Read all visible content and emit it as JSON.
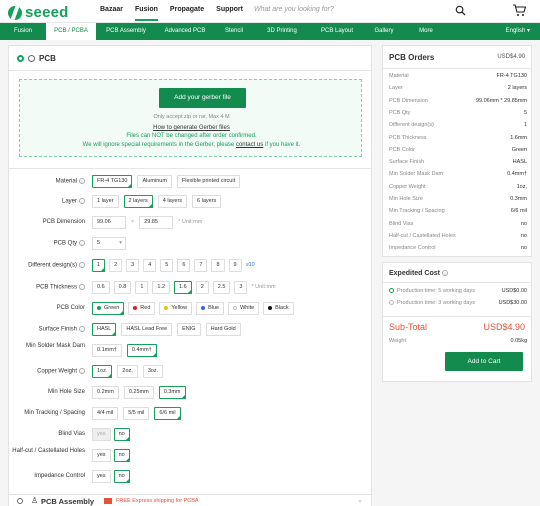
{
  "header": {
    "logo_text": "seeed",
    "nav": [
      "Bazaar",
      "Fusion",
      "Propagate",
      "Support"
    ],
    "search_placeholder": "What are you looking for?"
  },
  "subnav": {
    "items": [
      "Fusion",
      "PCB / PCBA",
      "PCB Assembly",
      "Advanced PCB",
      "Stencil",
      "3D Printing",
      "PCB Layout",
      "Gallery",
      "More"
    ],
    "active": "PCB / PCBA",
    "language": "English"
  },
  "pcb": {
    "title": "PCB",
    "upload": {
      "button": "Add your gerber file",
      "hint": "Only accept zip or rar, Max 4 M",
      "link": "How to generate Gerber files",
      "warn1": "Files can NOT be changed after order confirmed.",
      "warn2_pre": "We will ignore special requirements in the Gerber, please ",
      "warn2_link": "contact us",
      "warn2_post": " if you have it."
    },
    "fields": {
      "material": {
        "label": "Material",
        "options": [
          "FR-4 TG130",
          "Aluminum",
          "Flexible printed circuit"
        ],
        "selected": 0
      },
      "layer": {
        "label": "Layer",
        "options": [
          "1 layer",
          "2 layers",
          "4 layers",
          "6 layers"
        ],
        "selected": 1
      },
      "dimension": {
        "label": "PCB Dimension",
        "w": "99.06",
        "h": "29.85",
        "unit": "* Unit:mm"
      },
      "qty": {
        "label": "PCB Qty",
        "value": "5"
      },
      "designs": {
        "label": "Different design(s)",
        "options": [
          "1",
          "2",
          "3",
          "4",
          "5",
          "6",
          "7",
          "8",
          "9"
        ],
        "selected": 0,
        "extra": "≥10"
      },
      "thickness": {
        "label": "PCB Thickness",
        "options": [
          "0.6",
          "0.8",
          "1",
          "1.2",
          "1.6",
          "2",
          "2.5",
          "3"
        ],
        "selected": 4,
        "unit": "* Unit:mm"
      },
      "color": {
        "label": "PCB Color",
        "options": [
          {
            "name": "Green",
            "color": "#16a05a"
          },
          {
            "name": "Red",
            "color": "#e02020"
          },
          {
            "name": "Yellow",
            "color": "#f2c200"
          },
          {
            "name": "Blue",
            "color": "#2a6fd6"
          },
          {
            "name": "White",
            "color": "#ffffff"
          },
          {
            "name": "Black",
            "color": "#111111"
          }
        ],
        "selected": 0
      },
      "finish": {
        "label": "Surface Finish",
        "options": [
          "HASL",
          "HASL Lead Free",
          "ENIG",
          "Hard Gold"
        ],
        "selected": 0
      },
      "mask_dam": {
        "label": "Min Solder Mask Dam",
        "options": [
          "0.1mm†",
          "0.4mm†"
        ],
        "selected": 1
      },
      "copper": {
        "label": "Copper Weight",
        "options": [
          "1oz.",
          "2oz.",
          "3oz."
        ],
        "selected": 0
      },
      "hole": {
        "label": "Min Hole Size",
        "options": [
          "0.2mm",
          "0.25mm",
          "0.3mm"
        ],
        "selected": 2
      },
      "tracking": {
        "label": "Min Tracking / Spacing",
        "options": [
          "4/4 mil",
          "5/5 mil",
          "6/6 mil"
        ],
        "selected": 2
      },
      "blind": {
        "label": "Blind Vias",
        "options": [
          "yes",
          "no"
        ],
        "selected": 1
      },
      "halfcut": {
        "label": "Half-cut / Castellated Holes",
        "options": [
          "yes",
          "no"
        ],
        "selected": 1
      },
      "impedance": {
        "label": "Impedance Control",
        "options": [
          "yes",
          "no"
        ],
        "selected": 1
      }
    }
  },
  "assembly": {
    "title": "PCB Assembly",
    "promo": "FREE Express shipping for PCBA"
  },
  "orders": {
    "title": "PCB Orders",
    "price": "USD$4.90",
    "rows": [
      {
        "k": "Material",
        "v": "FR-4 TG130"
      },
      {
        "k": "Layer",
        "v": "2 layers"
      },
      {
        "k": "PCB Dimension",
        "v": "99.06mm * 29.85mm"
      },
      {
        "k": "PCB Qty",
        "v": "5"
      },
      {
        "k": "Different design(s)",
        "v": "1"
      },
      {
        "k": "PCB Thickness",
        "v": "1.6mm"
      },
      {
        "k": "PCB Color",
        "v": "Green"
      },
      {
        "k": "Surface Finish",
        "v": "HASL"
      },
      {
        "k": "Min Solder Mask Dam",
        "v": "0.4mm†"
      },
      {
        "k": "Copper Weight",
        "v": "1oz."
      },
      {
        "k": "Min Hole Size",
        "v": "0.3mm"
      },
      {
        "k": "Min Tracking / Spacing",
        "v": "6/6 mil"
      },
      {
        "k": "Blind Vias",
        "v": "no"
      },
      {
        "k": "Half-cut / Castellated Holes",
        "v": "no"
      },
      {
        "k": "Impedance Control",
        "v": "no"
      }
    ]
  },
  "expedited": {
    "title": "Expedited Cost",
    "options": [
      {
        "label": "Production time: 5 working days",
        "price": "USD$0.00"
      },
      {
        "label": "Production time: 3 working days",
        "price": "USD$30.00"
      }
    ],
    "subtotal_label": "Sub-Total",
    "subtotal": "USD$4.90",
    "weight_label": "Weight",
    "weight": "0.05kg",
    "cart_button": "Add to Cart"
  },
  "colors": {
    "brand": "#16a05a",
    "bar": "#138a4e",
    "subtotal": "#e8503a"
  }
}
